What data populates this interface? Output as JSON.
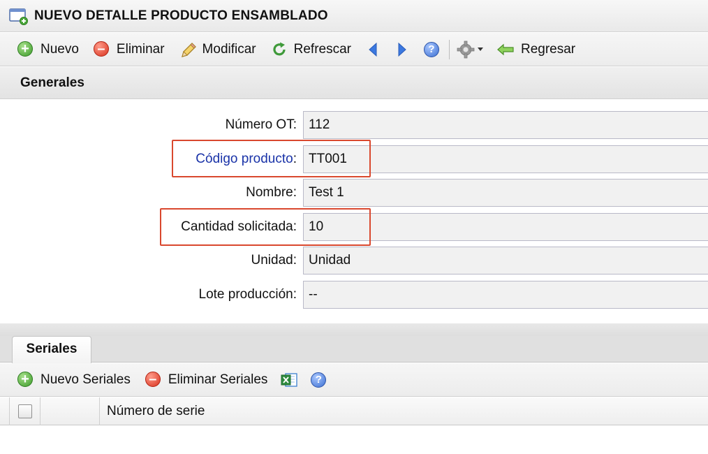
{
  "window": {
    "title": "NUEVO DETALLE PRODUCTO ENSAMBLADO",
    "icon": "window-add-icon"
  },
  "toolbar": {
    "nuevo": "Nuevo",
    "eliminar": "Eliminar",
    "modificar": "Modificar",
    "refrescar": "Refrescar",
    "regresar": "Regresar",
    "icons": [
      "add-icon",
      "delete-icon",
      "pencil-icon",
      "refresh-icon",
      "arrow-left-icon",
      "arrow-right-icon",
      "help-icon",
      "gear-icon",
      "back-arrow-icon"
    ]
  },
  "section": {
    "title": "Generales"
  },
  "form": {
    "numero_ot": {
      "label": "Número OT",
      "value": "112"
    },
    "codigo_producto": {
      "label": "Código producto",
      "value": "TT001"
    },
    "nombre": {
      "label": "Nombre",
      "value": "Test 1"
    },
    "cantidad_solicitada": {
      "label": "Cantidad solicitada",
      "value": "10"
    },
    "unidad": {
      "label": "Unidad",
      "value": "Unidad"
    },
    "lote_produccion": {
      "label": "Lote producción",
      "value": "--"
    },
    "colon": ":"
  },
  "tabs": [
    {
      "label": "Seriales"
    }
  ],
  "subtoolbar": {
    "nuevo_seriales": "Nuevo Seriales",
    "eliminar_seriales": "Eliminar Seriales",
    "icons": [
      "add-icon",
      "delete-icon",
      "excel-export-icon",
      "help-icon"
    ]
  },
  "grid": {
    "columns": [
      "Número de serie"
    ],
    "rows": []
  },
  "colors": {
    "link_label": "#1a33a8",
    "highlight": "#d9482e"
  }
}
